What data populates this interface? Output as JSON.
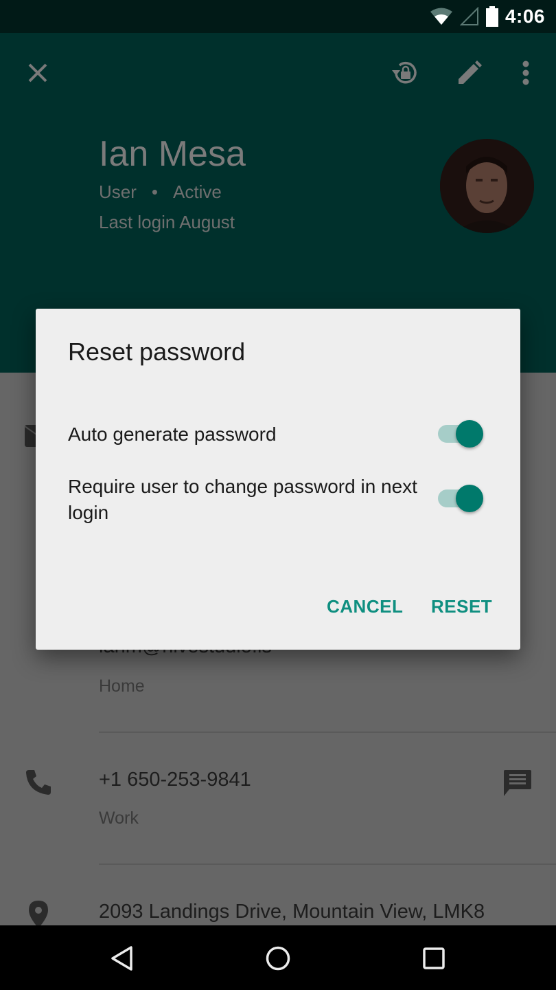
{
  "status_bar": {
    "time": "4:06",
    "icons": [
      "wifi-icon",
      "cell-signal-icon",
      "battery-icon"
    ]
  },
  "header": {
    "actions": [
      "close-icon",
      "lock-reset-icon",
      "edit-icon",
      "more-vert-icon"
    ],
    "name": "Ian Mesa",
    "role": "User",
    "separator": "•",
    "status": "Active",
    "last_login": "Last login August"
  },
  "contact": {
    "email_partial": "ianm@hivestudio.is",
    "email_label": "Home",
    "phone": "+1 650-253-9841",
    "phone_label": "Work",
    "address": "2093 Landings Drive, Mountain View, LMK8"
  },
  "dialog": {
    "title": "Reset password",
    "options": [
      {
        "label": "Auto generate password",
        "checked": true
      },
      {
        "label": "Require user to change password in next login",
        "checked": true
      }
    ],
    "cancel_label": "CANCEL",
    "confirm_label": "RESET"
  },
  "colors": {
    "accent": "#00796b",
    "button_text": "#0f8f80",
    "header_bg": "#00302c",
    "scrim": "#666666"
  }
}
